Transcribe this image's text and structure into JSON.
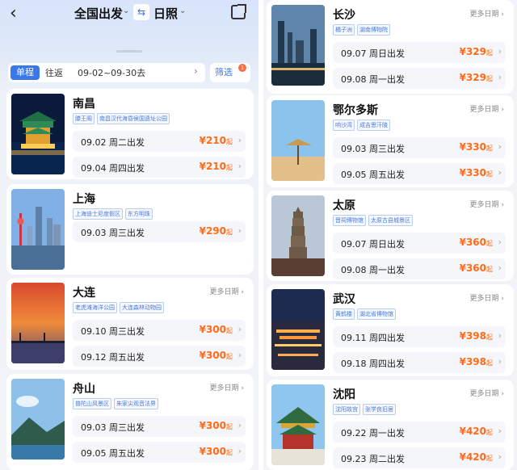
{
  "header": {
    "origin": "全国出发",
    "destination": "日照"
  },
  "filter": {
    "one_way": "单程",
    "round_trip": "往返",
    "date_range": "09-02~09-30去",
    "filter_label": "筛选",
    "filter_badge": "1"
  },
  "more_dates_label": "更多日期",
  "start_suffix": "起",
  "destinations": [
    {
      "city": "南昌",
      "tags": [
        "滕王阁",
        "南昌汉代海昏侯国遗址公园"
      ],
      "dates": [
        {
          "label": "09.02 周二出发",
          "price": "¥210"
        },
        {
          "label": "09.04 周四出发",
          "price": "¥210"
        }
      ],
      "more": false
    },
    {
      "city": "上海",
      "tags": [
        "上海迪士尼度假区",
        "东方明珠"
      ],
      "dates": [
        {
          "label": "09.03 周三出发",
          "price": "¥290"
        }
      ],
      "more": false
    },
    {
      "city": "大连",
      "tags": [
        "老虎滩海洋公园",
        "大连森林动物园"
      ],
      "dates": [
        {
          "label": "09.10 周三出发",
          "price": "¥300"
        },
        {
          "label": "09.12 周五出发",
          "price": "¥300"
        }
      ],
      "more": true
    },
    {
      "city": "舟山",
      "tags": [
        "普陀山风景区",
        "朱家尖观音法界"
      ],
      "dates": [
        {
          "label": "09.03 周三出发",
          "price": "¥300"
        },
        {
          "label": "09.05 周五出发",
          "price": "¥300"
        }
      ],
      "more": true
    },
    {
      "city": "长沙",
      "tags": [
        "橘子洲",
        "湖南博物院"
      ],
      "dates": [
        {
          "label": "09.07 周日出发",
          "price": "¥329"
        },
        {
          "label": "09.08 周一出发",
          "price": "¥329"
        }
      ],
      "more": true
    },
    {
      "city": "鄂尔多斯",
      "tags": [
        "响沙湾",
        "成吉思汗陵"
      ],
      "dates": [
        {
          "label": "09.03 周三出发",
          "price": "¥330"
        },
        {
          "label": "09.05 周五出发",
          "price": "¥330"
        }
      ],
      "more": true
    },
    {
      "city": "太原",
      "tags": [
        "晋祠博物馆",
        "太原古县城景区"
      ],
      "dates": [
        {
          "label": "09.07 周日出发",
          "price": "¥360"
        },
        {
          "label": "09.08 周一出发",
          "price": "¥360"
        }
      ],
      "more": true
    },
    {
      "city": "武汉",
      "tags": [
        "黄鹤楼",
        "湖北省博物馆"
      ],
      "dates": [
        {
          "label": "09.11 周四出发",
          "price": "¥398"
        },
        {
          "label": "09.18 周四出发",
          "price": "¥398"
        }
      ],
      "more": true
    },
    {
      "city": "沈阳",
      "tags": [
        "沈阳故宫",
        "张学良旧居"
      ],
      "dates": [
        {
          "label": "09.22 周一出发",
          "price": "¥420"
        },
        {
          "label": "09.23 周二出发",
          "price": "¥420"
        }
      ],
      "more": true
    }
  ]
}
